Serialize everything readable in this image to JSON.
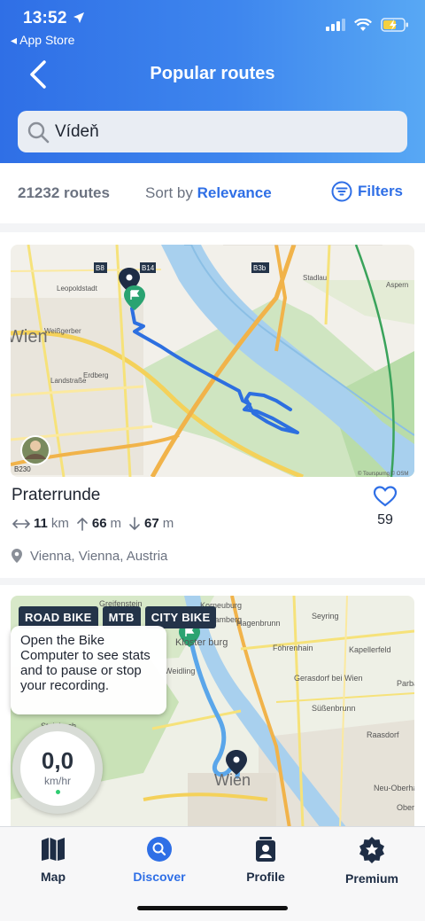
{
  "status_bar": {
    "time": "13:52",
    "back_app": "◂ App Store"
  },
  "header": {
    "title": "Popular routes"
  },
  "search": {
    "value": "Vídeň"
  },
  "results": {
    "count": "21232 routes",
    "sort_prefix": "Sort by",
    "sort_value": "Relevance",
    "filters_label": "Filters"
  },
  "routes": [
    {
      "name": "Praterrunde",
      "distance": "11",
      "distance_unit": "km",
      "ascent": "66",
      "ascent_unit": "m",
      "descent": "67",
      "descent_unit": "m",
      "location": "Vienna, Vienna, Austria",
      "likes": "59",
      "map_labels": {
        "b8": "B8",
        "b14": "B14",
        "b3b": "B3b",
        "b230": "B230",
        "wien": "Wien",
        "leopoldstadt": "Leopoldstadt",
        "weissgerber": "Weißgerber",
        "landstrasse": "Landstraße",
        "erdberg": "Erdberg",
        "stadlau": "Stadlau",
        "aspern": "Aspern",
        "credit": "© Tourspurng © OSM"
      }
    },
    {
      "tags": [
        "ROAD BIKE",
        "MTB",
        "CITY BIKE"
      ],
      "map_labels": {
        "korneuburg": "Korneuburg",
        "greifenstein": "Greifenstein",
        "hagenbrunn": "Hagenbrunn",
        "seyring": "Seyring",
        "fohrenhain": "Föhrenhain",
        "kapellerfeld": "Kapellerfeld",
        "gerasdorf": "Gerasdorf bei Wien",
        "sussenbrunn": "Süßenbrunn",
        "raasdorf": "Raasdorf",
        "parba": "Parba",
        "neuoberhau": "Neu-Oberhau",
        "steinbach": "Steinbach",
        "weidling": "Weidling",
        "wien": "Wien",
        "oberhau": "Oberhau",
        "samberg": "samberg",
        "klosterneuburg": "Kloster   burg"
      }
    }
  ],
  "tooltip": {
    "text": "Open the Bike Computer to see stats and to pause or stop your recording."
  },
  "bike_computer": {
    "speed": "0,0",
    "unit": "km/hr"
  },
  "tabs": [
    {
      "label": "Map",
      "icon": "map-icon"
    },
    {
      "label": "Discover",
      "icon": "discover-icon",
      "active": true
    },
    {
      "label": "Profile",
      "icon": "profile-icon"
    },
    {
      "label": "Premium",
      "icon": "premium-star-icon"
    }
  ],
  "colors": {
    "brand_blue": "#2f6fe6",
    "route_blue": "#2d6fe0",
    "tag_bg": "#243449"
  }
}
